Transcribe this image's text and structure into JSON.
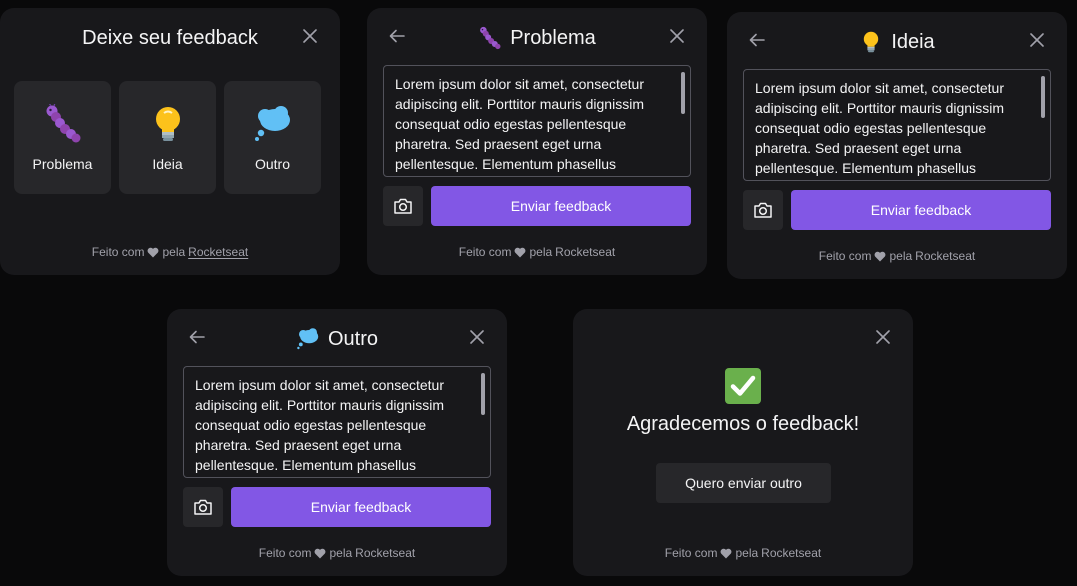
{
  "colors": {
    "background": "#09090a",
    "card": "#18181b",
    "surface": "#27272a",
    "brand": "#8257e5",
    "text": "#f4f4f5",
    "muted": "#a1a1aa"
  },
  "icons": {
    "close": "close-icon",
    "back": "arrow-left-icon",
    "camera": "camera-icon",
    "bug": "caterpillar-icon",
    "idea": "lightbulb-icon",
    "other": "thought-balloon-icon",
    "success": "check-mark-icon",
    "heart": "heart-icon"
  },
  "footer": {
    "prefix": "Feito com",
    "suffix": "pela",
    "brand": "Rocketseat"
  },
  "choose": {
    "title": "Deixe seu feedback",
    "types": [
      {
        "label": "Problema"
      },
      {
        "label": "Ideia"
      },
      {
        "label": "Outro"
      }
    ]
  },
  "forms": [
    {
      "title": "Problema"
    },
    {
      "title": "Ideia"
    },
    {
      "title": "Outro"
    }
  ],
  "comment_text": "Lorem ipsum dolor sit amet, consectetur adipiscing elit. Porttitor mauris dignissim consequat odio egestas pellentesque pharetra. Sed praesent eget urna pellentesque. Elementum phasellus",
  "send_label": "Enviar feedback",
  "success": {
    "title": "Agradecemos o feedback!",
    "again_label": "Quero enviar outro"
  }
}
